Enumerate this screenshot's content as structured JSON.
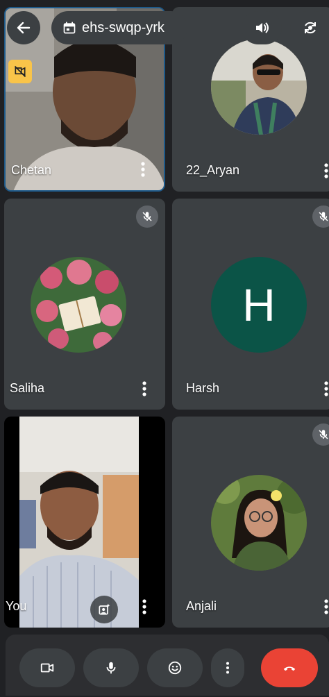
{
  "meeting": {
    "code": "ehs-swqp-yrk"
  },
  "participants": [
    {
      "name": "Chetan"
    },
    {
      "name": "22_Aryan"
    },
    {
      "name": "Saliha"
    },
    {
      "name": "Harsh",
      "initial": "H"
    },
    {
      "name": "You"
    },
    {
      "name": "Anjali"
    }
  ],
  "colors": {
    "accent_avatar": "#0b5447",
    "end_call": "#ea4335",
    "tile": "#3c4043",
    "background": "#202124"
  },
  "icons": [
    "back-arrow-icon",
    "calendar-icon",
    "speaker-icon",
    "switch-camera-icon",
    "video-off-badge-icon",
    "mic-off-icon",
    "more-vert-icon",
    "effects-icon",
    "camera-icon",
    "mic-icon",
    "emoji-icon",
    "end-call-icon"
  ]
}
